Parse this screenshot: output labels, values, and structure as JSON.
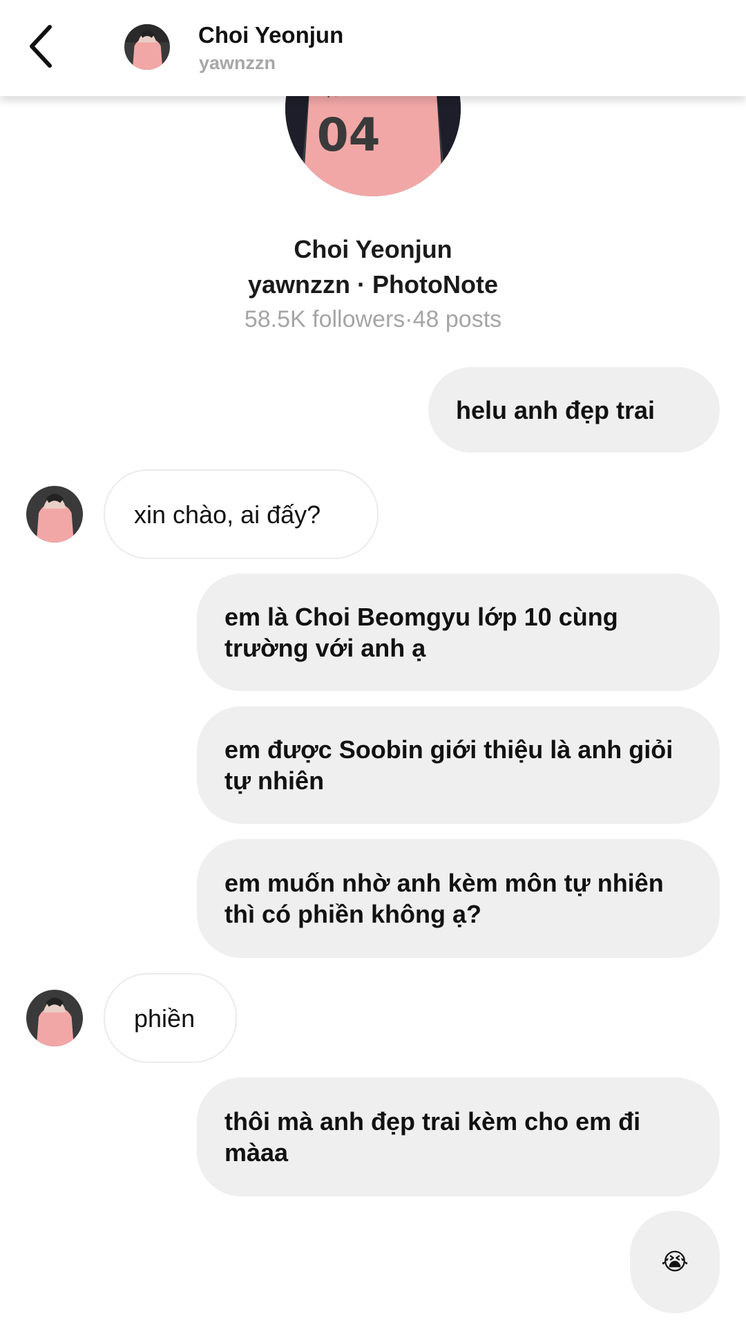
{
  "header": {
    "name": "Choi Yeonjun",
    "username": "yawnzzn"
  },
  "profile": {
    "name": "Choi Yeonjun",
    "username_source": "yawnzzn · PhotoNote",
    "followers": "58.5K followers",
    "separator": "·",
    "posts": "48 posts"
  },
  "colors": {
    "sent_bubble": "#efefef",
    "received_border": "#ebebeb",
    "secondary_text": "#a5a5a5",
    "avatar_shirt": "#f2a7a7"
  },
  "messages": [
    {
      "direction": "sent",
      "text": "helu anh đẹp trai"
    },
    {
      "direction": "received",
      "text": "xin chào, ai đấy?"
    },
    {
      "direction": "sent",
      "text": "em là Choi Beomgyu lớp 10 cùng trường với anh ạ"
    },
    {
      "direction": "sent",
      "text": "em được Soobin giới thiệu là anh giỏi tự nhiên"
    },
    {
      "direction": "sent",
      "text": "em muốn nhờ anh kèm môn tự nhiên thì có phiền không ạ?"
    },
    {
      "direction": "received",
      "text": "phiền"
    },
    {
      "direction": "sent",
      "text": "thôi mà anh đẹp trai kèm cho em đi màaa"
    },
    {
      "direction": "sent",
      "text": "😭"
    }
  ]
}
